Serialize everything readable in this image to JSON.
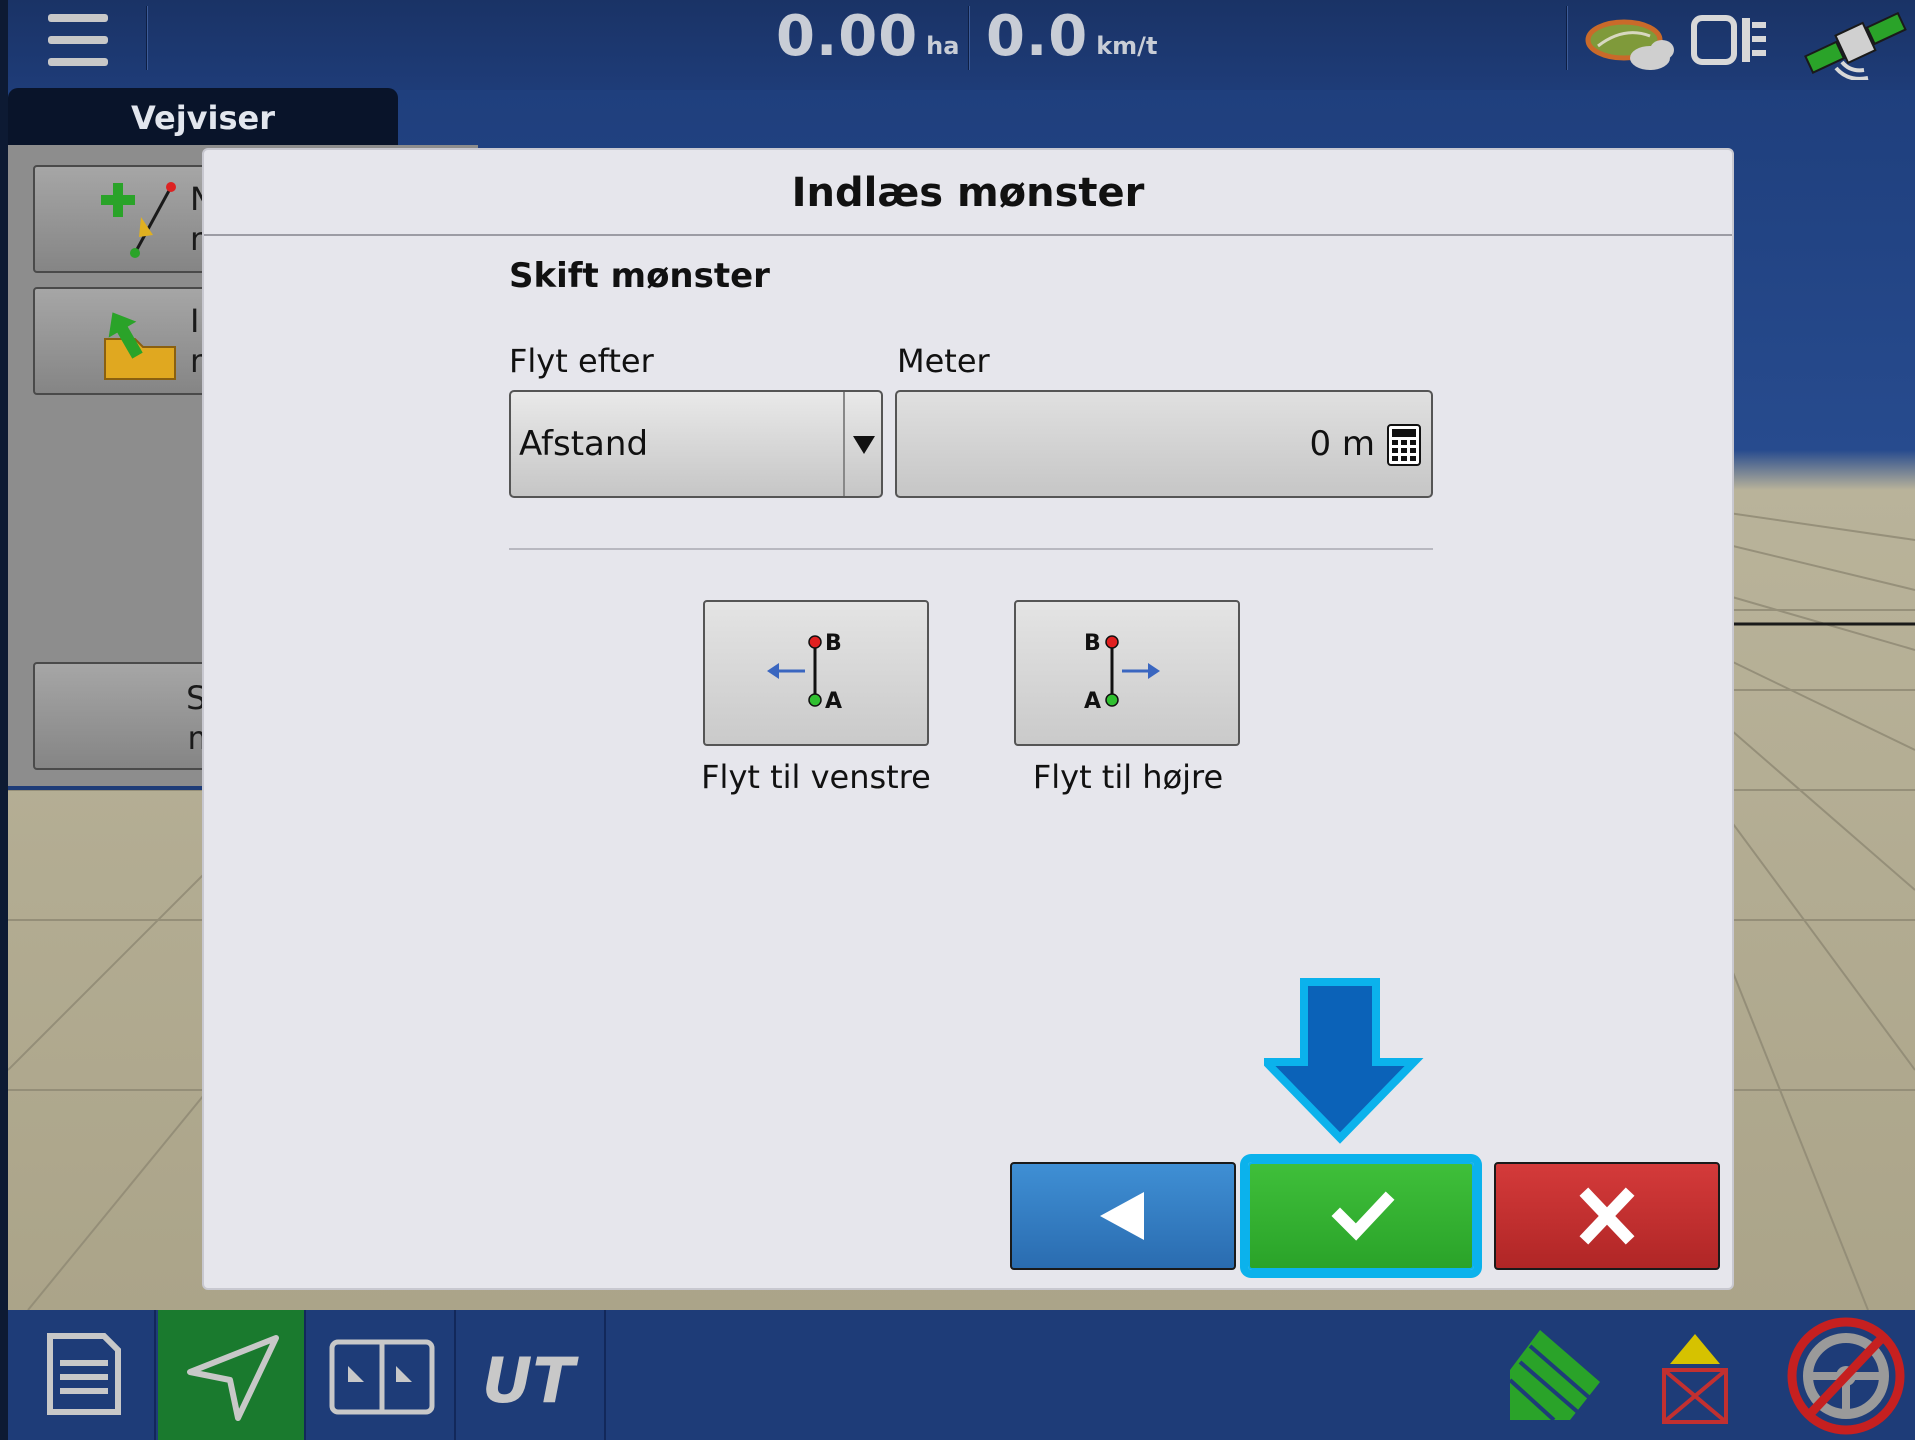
{
  "statusbar": {
    "area_value": "0.00",
    "area_unit": "ha",
    "speed_value": "0.0",
    "speed_unit": "km/t",
    "icons": [
      "hamburger-menu-icon",
      "gnss-signal-icon",
      "display-mode-icon",
      "satellite-icon"
    ]
  },
  "panel": {
    "tab_label": "Vejviser",
    "buttons": [
      {
        "label": "N\nm",
        "icon": "new-pattern-icon"
      },
      {
        "label": "Ir\nm",
        "icon": "load-pattern-icon"
      },
      {
        "label": "Styri\nmøn",
        "icon": ""
      }
    ]
  },
  "dialog": {
    "title": "Indlæs mønster",
    "section_title": "Skift mønster",
    "shift_by": {
      "label": "Flyt efter",
      "value": "Afstand"
    },
    "meter": {
      "label": "Meter",
      "value": "0 m"
    },
    "shift_left_label": "Flyt til venstre",
    "shift_right_label": "Flyt til højre",
    "point_a": "A",
    "point_b": "B",
    "actions": {
      "back": "back-arrow-icon",
      "confirm": "checkmark-icon",
      "cancel": "x-icon"
    },
    "accent_colors": {
      "back": "#2f78c0",
      "confirm": "#33b330",
      "cancel": "#c23030",
      "highlight": "#0bb2ec"
    }
  },
  "bottombar": {
    "items": [
      "document-icon",
      "guidance-icon",
      "split-screen-icon",
      "universal-terminal-icon"
    ],
    "active_index": 1,
    "right_icons": [
      "field-coverage-icon",
      "mapping-warning-icon",
      "steering-disabled-icon"
    ]
  }
}
